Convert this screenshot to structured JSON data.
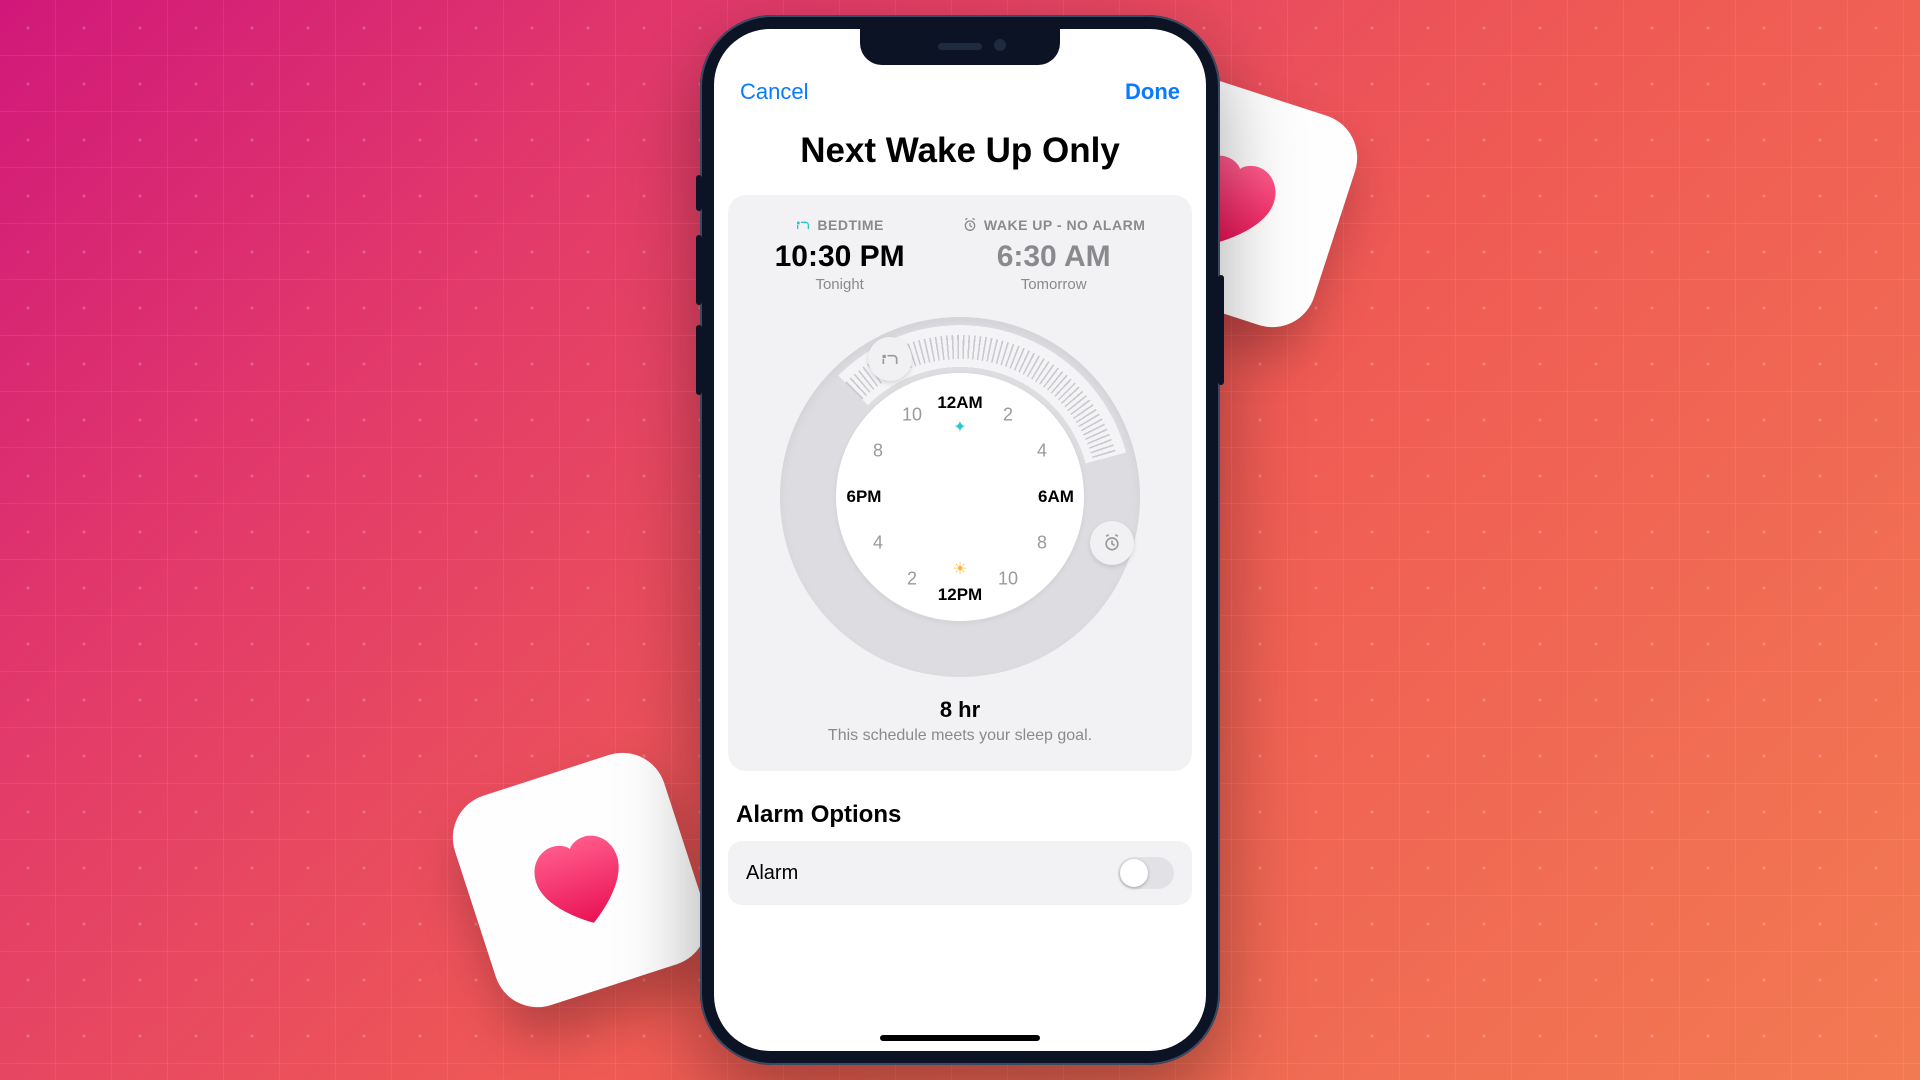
{
  "nav": {
    "cancel": "Cancel",
    "done": "Done"
  },
  "title": "Next Wake Up Only",
  "schedule": {
    "bedtime": {
      "label": "BEDTIME",
      "time": "10:30 PM",
      "day": "Tonight",
      "icon": "bed-icon"
    },
    "wakeup": {
      "label": "WAKE UP - NO ALARM",
      "time": "6:30 AM",
      "day": "Tomorrow",
      "icon": "alarm-icon"
    },
    "clock": {
      "top": "12AM",
      "bottom": "12PM",
      "right": "6AM",
      "left": "6PM",
      "n2_tr": "2",
      "n4_r": "4",
      "n8_l": "8",
      "n10_tl": "10",
      "n2_bl": "2",
      "n4_bl": "4",
      "n8_br": "8",
      "n10_br": "10"
    },
    "duration": {
      "hours": "8 hr",
      "message": "This schedule meets your sleep goal."
    }
  },
  "alarm_section": {
    "title": "Alarm Options"
  },
  "alarm_row": {
    "label": "Alarm",
    "enabled": false
  },
  "colors": {
    "accent_blue": "#0a7aff",
    "accent_teal": "#2cc6c9"
  }
}
